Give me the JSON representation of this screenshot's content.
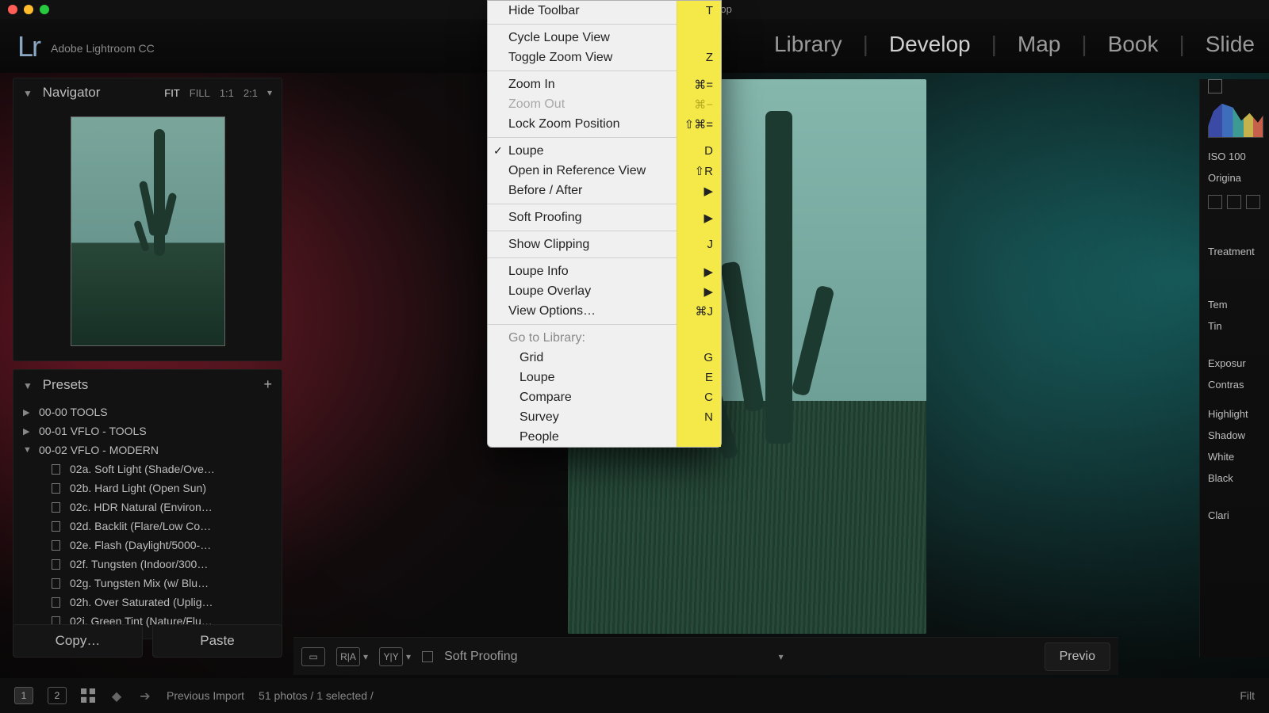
{
  "window": {
    "title": "at - Adobe Photoshop Lightroom - Develop"
  },
  "brand": {
    "logo": "Lr",
    "name": "Adobe Lightroom CC"
  },
  "modules": {
    "items": [
      "Library",
      "Develop",
      "Map",
      "Book",
      "Slide"
    ],
    "active": 1,
    "sep": "|"
  },
  "navigator": {
    "title": "Navigator",
    "zoom": {
      "fit": "FIT",
      "fill": "FILL",
      "one": "1:1",
      "two": "2:1"
    }
  },
  "presets": {
    "title": "Presets",
    "add": "+",
    "folders": [
      {
        "open": false,
        "label": "00-00 TOOLS"
      },
      {
        "open": false,
        "label": "00-01 VFLO - TOOLS"
      },
      {
        "open": true,
        "label": "00-02 VFLO - MODERN"
      }
    ],
    "children": [
      "02a. Soft Light (Shade/Ove…",
      "02b. Hard Light (Open Sun)",
      "02c. HDR Natural (Environ…",
      "02d. Backlit (Flare/Low Co…",
      "02e. Flash (Daylight/5000-…",
      "02f. Tungsten (Indoor/300…",
      "02g. Tungsten Mix (w/ Blu…",
      "02h. Over Saturated (Uplig…",
      "02i. Green Tint (Nature/Flu…"
    ]
  },
  "left_buttons": {
    "copy": "Copy…",
    "paste": "Paste"
  },
  "bottom_toolbar": {
    "soft_proof_label": "Soft Proofing",
    "previous": "Previo"
  },
  "filmstrip": {
    "num1": "1",
    "num2": "2",
    "source": "Previous Import",
    "count": "51 photos / 1 selected /",
    "filter": "Filt"
  },
  "right": {
    "iso": "ISO 100",
    "original_chk": "Origina",
    "treatment": "Treatment",
    "temp": "Tem",
    "tint": "Tin",
    "exposure": "Exposur",
    "contrast": "Contras",
    "highlights": "Highlight",
    "shadows": "Shadow",
    "whites": "White",
    "blacks": "Black",
    "clarity": "Clari"
  },
  "menu": {
    "items": [
      {
        "type": "item",
        "label": "Hide Toolbar",
        "shortcut": "T"
      },
      {
        "type": "sep"
      },
      {
        "type": "item",
        "label": "Cycle Loupe View",
        "shortcut": ""
      },
      {
        "type": "item",
        "label": "Toggle Zoom View",
        "shortcut": "Z"
      },
      {
        "type": "sep"
      },
      {
        "type": "item",
        "label": "Zoom In",
        "shortcut": "⌘="
      },
      {
        "type": "item",
        "label": "Zoom Out",
        "shortcut": "⌘−",
        "disabled": true
      },
      {
        "type": "item",
        "label": "Lock Zoom Position",
        "shortcut": "⇧⌘="
      },
      {
        "type": "sep"
      },
      {
        "type": "item",
        "label": "Loupe",
        "shortcut": "D",
        "checked": true
      },
      {
        "type": "item",
        "label": "Open in Reference View",
        "shortcut": "⇧R"
      },
      {
        "type": "item",
        "label": "Before / After",
        "submenu": true
      },
      {
        "type": "sep"
      },
      {
        "type": "item",
        "label": "Soft Proofing",
        "submenu": true
      },
      {
        "type": "sep"
      },
      {
        "type": "item",
        "label": "Show Clipping",
        "shortcut": "J"
      },
      {
        "type": "sep"
      },
      {
        "type": "item",
        "label": "Loupe Info",
        "submenu": true
      },
      {
        "type": "item",
        "label": "Loupe Overlay",
        "submenu": true
      },
      {
        "type": "item",
        "label": "View Options…",
        "shortcut": "⌘J"
      },
      {
        "type": "sep"
      },
      {
        "type": "header",
        "label": "Go to Library:"
      },
      {
        "type": "item",
        "label": "Grid",
        "shortcut": "G",
        "indent": true
      },
      {
        "type": "item",
        "label": "Loupe",
        "shortcut": "E",
        "indent": true
      },
      {
        "type": "item",
        "label": "Compare",
        "shortcut": "C",
        "indent": true
      },
      {
        "type": "item",
        "label": "Survey",
        "shortcut": "N",
        "indent": true
      },
      {
        "type": "item",
        "label": "People",
        "shortcut": "",
        "indent": true
      }
    ]
  }
}
